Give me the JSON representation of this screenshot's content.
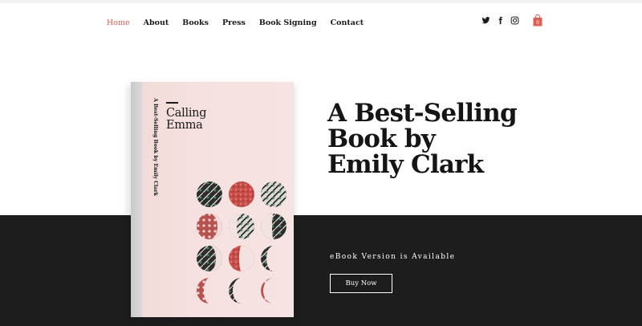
{
  "nav": {
    "items": [
      {
        "label": "Home",
        "active": true
      },
      {
        "label": "About",
        "active": false
      },
      {
        "label": "Books",
        "active": false
      },
      {
        "label": "Press",
        "active": false
      },
      {
        "label": "Book Signing",
        "active": false
      },
      {
        "label": "Contact",
        "active": false
      }
    ]
  },
  "social": {
    "icons": [
      "twitter-icon",
      "facebook-icon",
      "instagram-icon"
    ]
  },
  "cart": {
    "icon": "shopping-bag-icon",
    "count": "0"
  },
  "book": {
    "title_line1": "Calling",
    "title_line2": "Emma",
    "spine_text": "A Best-Selling Book by Emily Clark"
  },
  "hero": {
    "headline_line1": "A Best-Selling",
    "headline_line2": "Book by",
    "headline_line3": "Emily Clark",
    "ebook_note": "eBook Version is Available",
    "buy_label": "Buy Now"
  },
  "colors": {
    "accent": "#e05f52",
    "dark_band": "#1d1d1d",
    "cover_pink": "#f5e1df"
  }
}
